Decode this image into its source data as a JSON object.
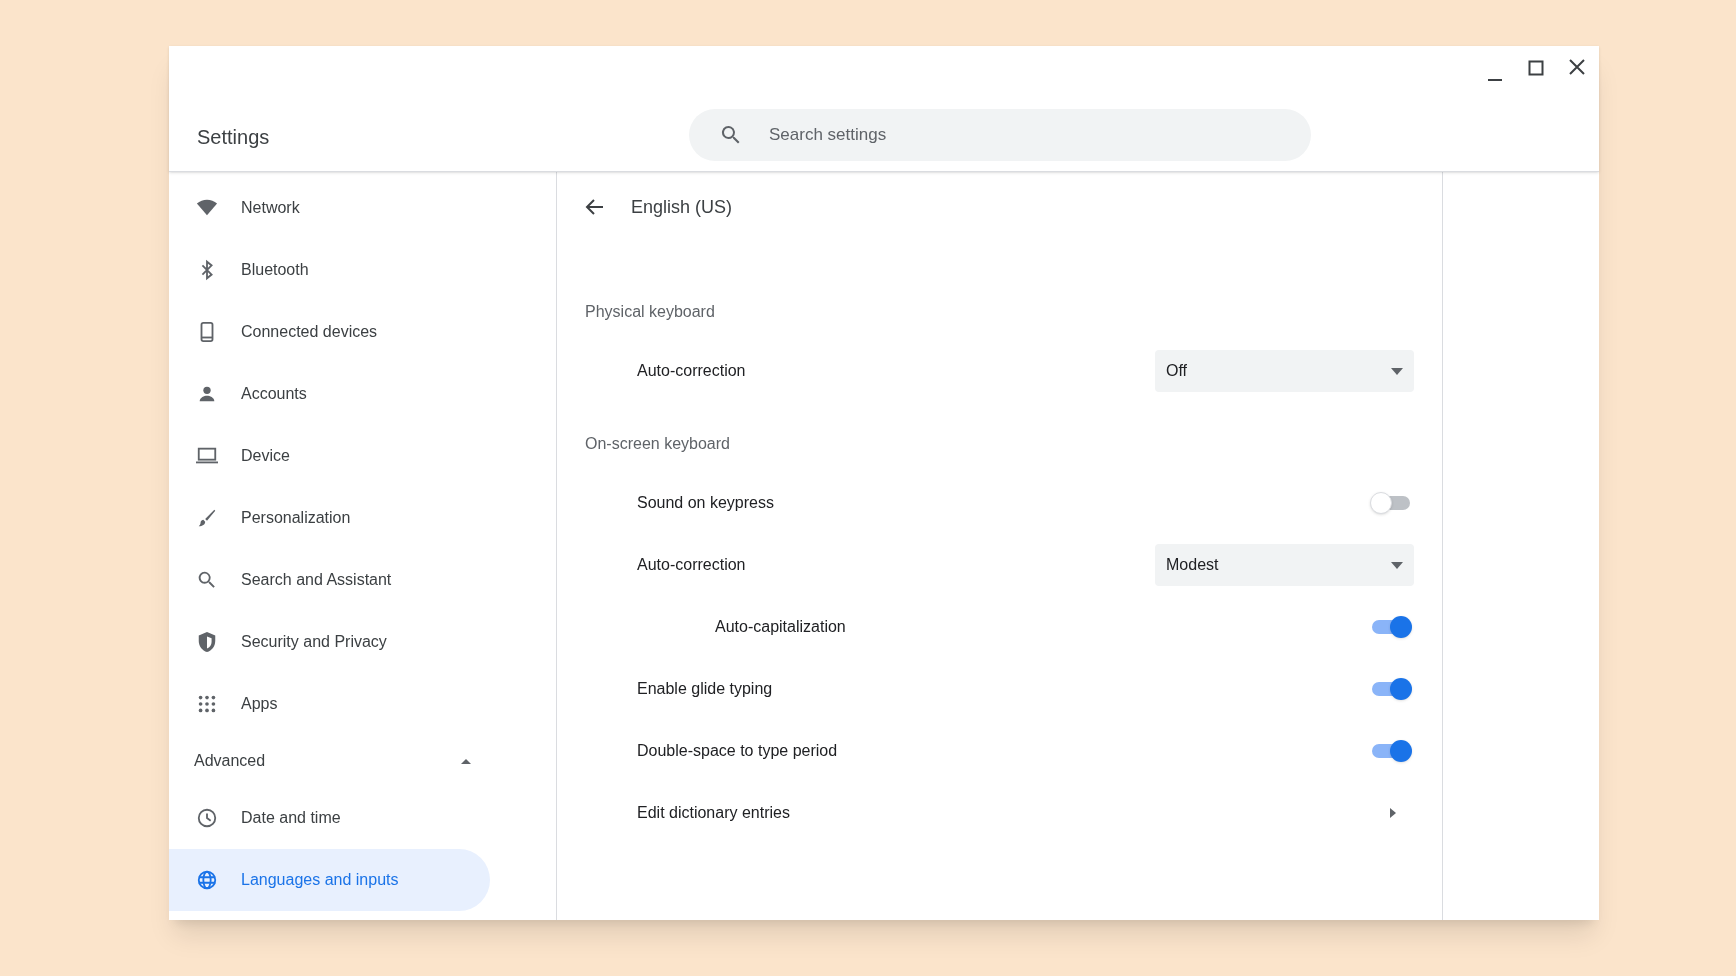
{
  "window": {
    "title": "Settings"
  },
  "search": {
    "placeholder": "Search settings"
  },
  "sidebar": {
    "items": [
      {
        "label": "Network",
        "selected": false
      },
      {
        "label": "Bluetooth",
        "selected": false
      },
      {
        "label": "Connected devices",
        "selected": false
      },
      {
        "label": "Accounts",
        "selected": false
      },
      {
        "label": "Device",
        "selected": false
      },
      {
        "label": "Personalization",
        "selected": false
      },
      {
        "label": "Search and Assistant",
        "selected": false
      },
      {
        "label": "Security and Privacy",
        "selected": false
      },
      {
        "label": "Apps",
        "selected": false
      }
    ],
    "advanced": {
      "label": "Advanced",
      "expanded": true,
      "items": [
        {
          "label": "Date and time",
          "selected": false
        },
        {
          "label": "Languages and inputs",
          "selected": true
        }
      ]
    }
  },
  "page": {
    "title": "English (US)",
    "sections": [
      {
        "title": "Physical keyboard",
        "rows": [
          {
            "kind": "dropdown",
            "label": "Auto-correction",
            "value": "Off"
          }
        ]
      },
      {
        "title": "On-screen keyboard",
        "rows": [
          {
            "kind": "toggle",
            "label": "Sound on keypress",
            "on": false
          },
          {
            "kind": "dropdown",
            "label": "Auto-correction",
            "value": "Modest",
            "children": [
              {
                "kind": "toggle",
                "label": "Auto-capitalization",
                "on": true
              }
            ]
          },
          {
            "kind": "toggle",
            "label": "Enable glide typing",
            "on": true
          },
          {
            "kind": "toggle",
            "label": "Double-space to type period",
            "on": true
          },
          {
            "kind": "link",
            "label": "Edit dictionary entries"
          }
        ]
      }
    ]
  }
}
